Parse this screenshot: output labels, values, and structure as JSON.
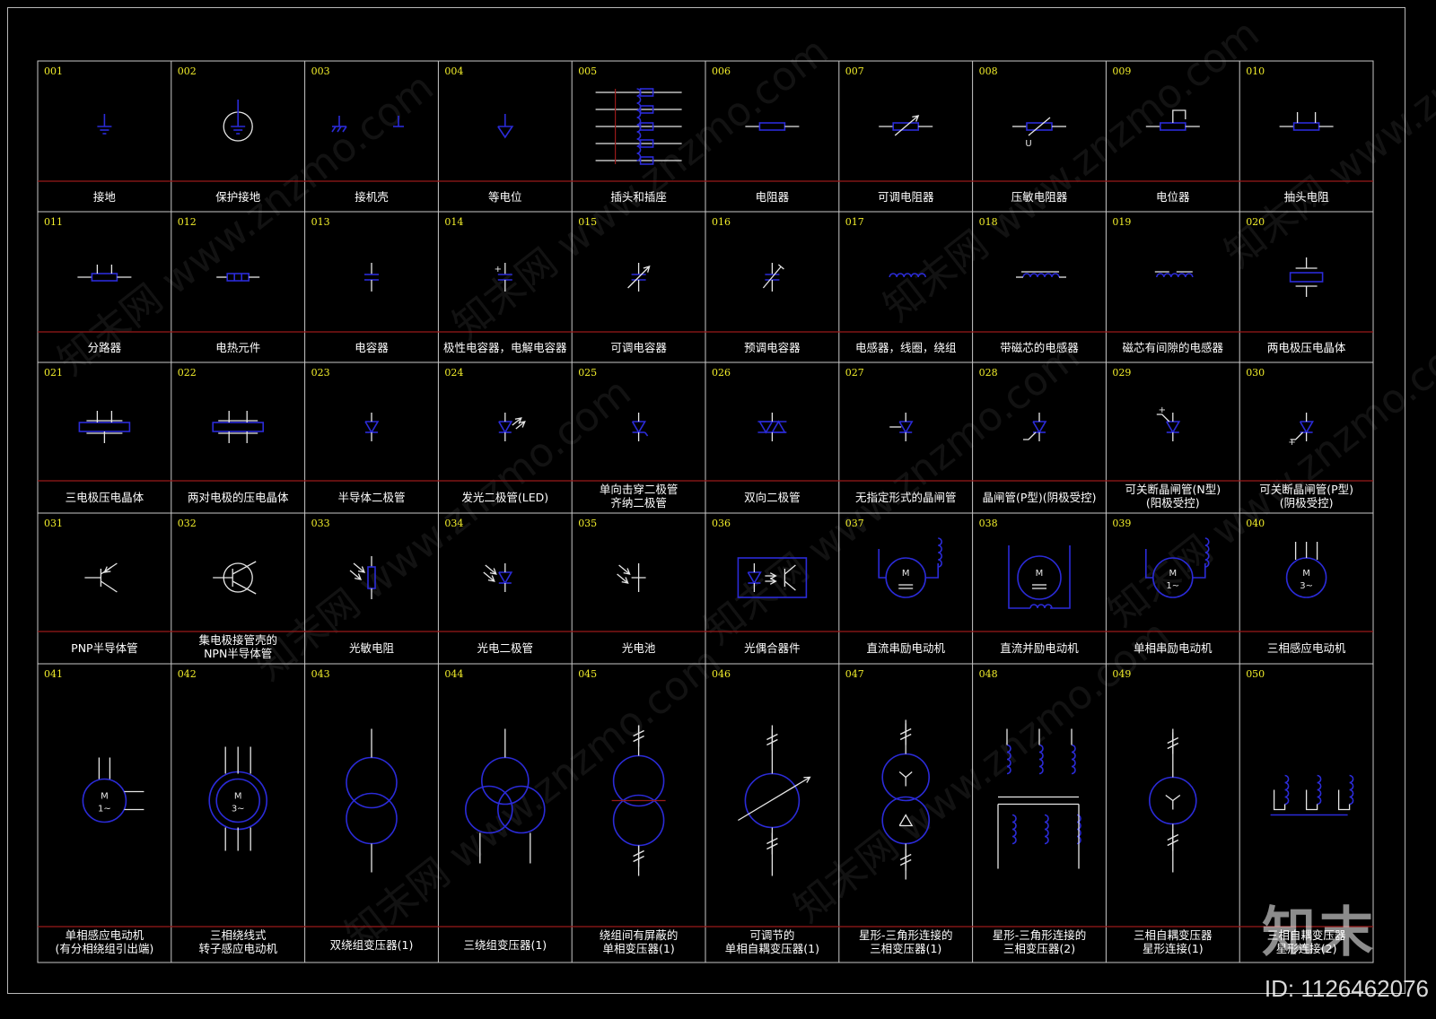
{
  "sheet": {
    "cells": [
      {
        "num": "001",
        "label": [
          "接地"
        ],
        "icon": "ground-symbol"
      },
      {
        "num": "002",
        "label": [
          "保护接地"
        ],
        "icon": "protective-ground-symbol"
      },
      {
        "num": "003",
        "label": [
          "接机壳"
        ],
        "icon": "chassis-ground-symbol"
      },
      {
        "num": "004",
        "label": [
          "等电位"
        ],
        "icon": "equipotential-symbol"
      },
      {
        "num": "005",
        "label": [
          "插头和插座"
        ],
        "icon": "plug-socket-symbol"
      },
      {
        "num": "006",
        "label": [
          "电阻器"
        ],
        "icon": "resistor-symbol"
      },
      {
        "num": "007",
        "label": [
          "可调电阻器"
        ],
        "icon": "variable-resistor-symbol"
      },
      {
        "num": "008",
        "label": [
          "压敏电阻器"
        ],
        "icon": "varistor-symbol"
      },
      {
        "num": "009",
        "label": [
          "电位器"
        ],
        "icon": "potentiometer-symbol"
      },
      {
        "num": "010",
        "label": [
          "抽头电阻"
        ],
        "icon": "tapped-resistor-symbol"
      },
      {
        "num": "011",
        "label": [
          "分路器"
        ],
        "icon": "shunt-symbol"
      },
      {
        "num": "012",
        "label": [
          "电热元件"
        ],
        "icon": "heating-element-symbol"
      },
      {
        "num": "013",
        "label": [
          "电容器"
        ],
        "icon": "capacitor-symbol"
      },
      {
        "num": "014",
        "label": [
          "极性电容器，电解电容器"
        ],
        "icon": "polarized-capacitor-symbol"
      },
      {
        "num": "015",
        "label": [
          "可调电容器"
        ],
        "icon": "variable-capacitor-symbol"
      },
      {
        "num": "016",
        "label": [
          "预调电容器"
        ],
        "icon": "preset-capacitor-symbol"
      },
      {
        "num": "017",
        "label": [
          "电感器，线圈，绕组"
        ],
        "icon": "inductor-symbol"
      },
      {
        "num": "018",
        "label": [
          "带磁芯的电感器"
        ],
        "icon": "cored-inductor-symbol"
      },
      {
        "num": "019",
        "label": [
          "磁芯有间隙的电感器"
        ],
        "icon": "gapped-core-inductor-symbol"
      },
      {
        "num": "020",
        "label": [
          "两电极压电晶体"
        ],
        "icon": "two-electrode-crystal-symbol"
      },
      {
        "num": "021",
        "label": [
          "三电极压电晶体"
        ],
        "icon": "three-electrode-crystal-symbol"
      },
      {
        "num": "022",
        "label": [
          "两对电极的压电晶体"
        ],
        "icon": "two-pair-crystal-symbol"
      },
      {
        "num": "023",
        "label": [
          "半导体二极管"
        ],
        "icon": "diode-symbol"
      },
      {
        "num": "024",
        "label": [
          "发光二极管(LED)"
        ],
        "icon": "led-symbol"
      },
      {
        "num": "025",
        "label": [
          "单向击穿二极管",
          "齐纳二极管"
        ],
        "icon": "zener-diode-symbol"
      },
      {
        "num": "026",
        "label": [
          "双向二极管"
        ],
        "icon": "bidirectional-diode-symbol"
      },
      {
        "num": "027",
        "label": [
          "无指定形式的晶闸管"
        ],
        "icon": "thyristor-symbol"
      },
      {
        "num": "028",
        "label": [
          "晶闸管(P型)(阴极受控)"
        ],
        "icon": "p-thyristor-symbol"
      },
      {
        "num": "029",
        "label": [
          "可关断晶闸管(N型)",
          "(阳极受控)"
        ],
        "icon": "gto-n-symbol"
      },
      {
        "num": "030",
        "label": [
          "可关断晶闸管(P型)",
          "(阴极受控)"
        ],
        "icon": "gto-p-symbol"
      },
      {
        "num": "031",
        "label": [
          "PNP半导体管"
        ],
        "icon": "pnp-transistor-symbol"
      },
      {
        "num": "032",
        "label": [
          "集电极接管壳的",
          "NPN半导体管"
        ],
        "icon": "npn-transistor-symbol"
      },
      {
        "num": "033",
        "label": [
          "光敏电阻"
        ],
        "icon": "photoresistor-symbol"
      },
      {
        "num": "034",
        "label": [
          "光电二极管"
        ],
        "icon": "photodiode-symbol"
      },
      {
        "num": "035",
        "label": [
          "光电池"
        ],
        "icon": "photocell-symbol"
      },
      {
        "num": "036",
        "label": [
          "光偶合器件"
        ],
        "icon": "optocoupler-symbol"
      },
      {
        "num": "037",
        "label": [
          "直流串励电动机"
        ],
        "icon": "dc-series-motor-symbol"
      },
      {
        "num": "038",
        "label": [
          "直流并励电动机"
        ],
        "icon": "dc-shunt-motor-symbol"
      },
      {
        "num": "039",
        "label": [
          "单相串励电动机"
        ],
        "icon": "single-phase-series-motor-symbol"
      },
      {
        "num": "040",
        "label": [
          "三相感应电动机"
        ],
        "icon": "three-phase-motor-symbol"
      },
      {
        "num": "041",
        "label": [
          "单相感应电动机",
          "(有分相绕组引出端)"
        ],
        "icon": "single-phase-induction-motor-symbol"
      },
      {
        "num": "042",
        "label": [
          "三相绕线式",
          "转子感应电动机"
        ],
        "icon": "wound-rotor-motor-symbol"
      },
      {
        "num": "043",
        "label": [
          "双绕组变压器(1)"
        ],
        "icon": "two-winding-transformer-symbol"
      },
      {
        "num": "044",
        "label": [
          "三绕组变压器(1)"
        ],
        "icon": "three-winding-transformer-symbol"
      },
      {
        "num": "045",
        "label": [
          "绕组间有屏蔽的",
          "单相变压器(1)"
        ],
        "icon": "shielded-transformer-symbol"
      },
      {
        "num": "046",
        "label": [
          "可调节的",
          "单相自耦变压器(1)"
        ],
        "icon": "variable-autotransformer-symbol"
      },
      {
        "num": "047",
        "label": [
          "星形-三角形连接的",
          "三相变压器(1)"
        ],
        "icon": "star-delta-transformer-1-symbol"
      },
      {
        "num": "048",
        "label": [
          "星形-三角形连接的",
          "三相变压器(2)"
        ],
        "icon": "star-delta-transformer-2-symbol"
      },
      {
        "num": "049",
        "label": [
          "三相自耦变压器",
          "星形连接(1)"
        ],
        "icon": "star-autotransformer-1-symbol"
      },
      {
        "num": "050",
        "label": [
          "三相自耦变压器",
          "星形连接(2)"
        ],
        "icon": "star-autotransformer-2-symbol"
      }
    ],
    "symbol_text": {
      "motor": "M",
      "single_phase": "1~",
      "three_phase": "3~"
    }
  },
  "watermark": {
    "text": "知末网 www.znzmo.com",
    "logo": "知末",
    "id": "ID: 1126462076"
  },
  "colors": {
    "background": "#000000",
    "grid": "#c8c8c8",
    "number": "#f2ee2a",
    "label": "#ffffff",
    "symbol": "#2b2bd8",
    "divider": "#9a1a1a"
  }
}
